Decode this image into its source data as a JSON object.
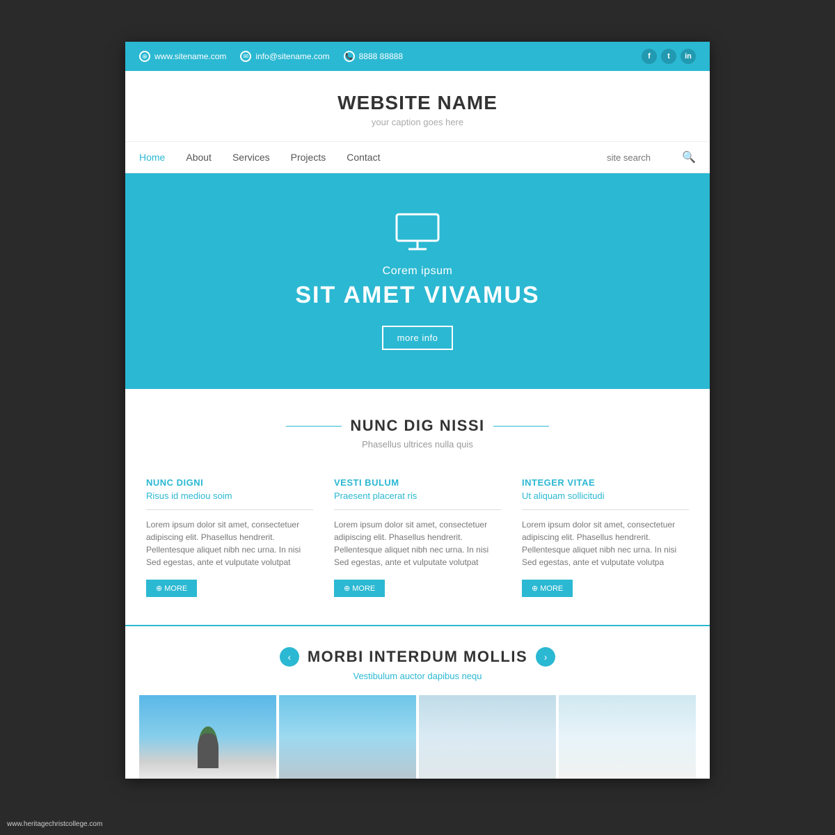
{
  "topbar": {
    "website": "www.sitename.com",
    "email": "info@sitename.com",
    "phone": "8888 88888",
    "social": [
      "f",
      "t",
      "in"
    ]
  },
  "header": {
    "site_name": "WEBSITE NAME",
    "caption": "your caption goes here"
  },
  "nav": {
    "links": [
      {
        "label": "Home",
        "active": true
      },
      {
        "label": "About",
        "active": false
      },
      {
        "label": "Services",
        "active": false
      },
      {
        "label": "Projects",
        "active": false
      },
      {
        "label": "Contact",
        "active": false
      }
    ],
    "search_placeholder": "site search"
  },
  "hero": {
    "subtitle": "Corem ipsum",
    "title": "SIT AMET VIVAMUS",
    "btn_label": "more info"
  },
  "features_section": {
    "title": "NUNC DIG NISSI",
    "subtitle": "Phasellus ultrices nulla quis",
    "cards": [
      {
        "title": "NUNC DIGNI",
        "subtitle": "Risus id mediou soim",
        "text": "Lorem ipsum dolor sit amet, consectetuer adipiscing elit. Phasellus hendrerit. Pellentesque aliquet nibh nec urna. In nisi Sed egestas, ante et vulputate volutpat",
        "btn": "MORE"
      },
      {
        "title": "VESTI BULUM",
        "subtitle": "Praesent placerat ris",
        "text": "Lorem ipsum dolor sit amet, consectetuer adipiscing elit. Phasellus hendrerit. Pellentesque aliquet nibh nec urna. In nisi Sed egestas, ante et vulputate volutpat",
        "btn": "MORE"
      },
      {
        "title": "INTEGER VITAE",
        "subtitle": "Ut aliquam sollicitudi",
        "text": "Lorem ipsum dolor sit amet, consectetuer adipiscing elit. Phasellus hendrerit. Pellentesque aliquet nibh nec urna. In nisi Sed egestas, ante et vulputate volutpa",
        "btn": "MORE"
      }
    ]
  },
  "slider_section": {
    "title": "MORBI INTERDUM MOLLIS",
    "subtitle": "Vestibulum auctor dapibus nequ"
  },
  "watermark": "www.heritagechristcollege.com"
}
